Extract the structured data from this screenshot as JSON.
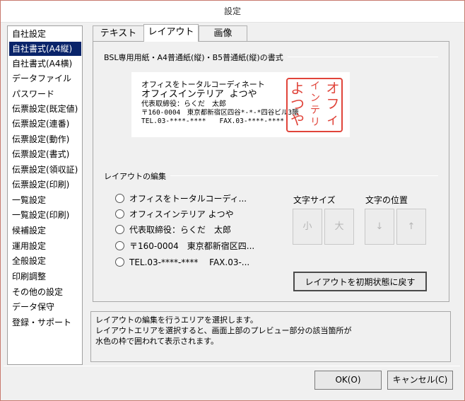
{
  "window": {
    "title": "設定"
  },
  "sidebar": {
    "items": [
      {
        "label": "自社設定"
      },
      {
        "label": "自社書式(A4縦)",
        "selected": true
      },
      {
        "label": "自社書式(A4横)"
      },
      {
        "label": "データファイル"
      },
      {
        "label": "パスワード"
      },
      {
        "label": "伝票設定(既定値)"
      },
      {
        "label": "伝票設定(連番)"
      },
      {
        "label": "伝票設定(動作)"
      },
      {
        "label": "伝票設定(書式)"
      },
      {
        "label": "伝票設定(領収証)"
      },
      {
        "label": "伝票設定(印刷)"
      },
      {
        "label": "一覧設定"
      },
      {
        "label": "一覧設定(印刷)"
      },
      {
        "label": "候補設定"
      },
      {
        "label": "運用設定"
      },
      {
        "label": "全般設定"
      },
      {
        "label": "印刷調整"
      },
      {
        "label": "その他の設定"
      },
      {
        "label": "データ保守"
      },
      {
        "label": "登録・サポート"
      }
    ]
  },
  "tabs": [
    {
      "label": "テキスト"
    },
    {
      "label": "レイアウト",
      "active": true
    },
    {
      "label": "画像"
    }
  ],
  "format_group": {
    "label": "BSL専用用紙・A4普通紙(縦)・B5普通紙(縦)の書式"
  },
  "preview": {
    "lines": [
      "オフィスをトータルコーディネート",
      "オフィスインテリア よつや",
      "代表取締役：らくだ　太郎",
      "〒160-0004　東京都新宿区四谷*-*-*四谷ビル3階",
      "TEL.03-****-****　　FAX.03-****-****"
    ],
    "stamp_columns": [
      "オフィ",
      "インテリ",
      "よつや"
    ],
    "stamp_color": "#e0443a"
  },
  "layout_edit": {
    "label": "レイアウトの編集",
    "options": [
      {
        "label": "オフィスをトータルコーディ..."
      },
      {
        "label": "オフィスインテリア よつや"
      },
      {
        "label": "代表取締役：らくだ　太郎"
      },
      {
        "label": "〒160-0004　東京都新宿区四..."
      },
      {
        "label": "TEL.03-****-****　 FAX.03-..."
      }
    ],
    "font_size_label": "文字サイズ",
    "small_button": "小",
    "large_button": "大",
    "position_label": "文字の位置",
    "down_button": "↓",
    "up_button": "↑",
    "reset_button": "レイアウトを初期状態に戻す"
  },
  "help": {
    "lines": [
      "レイアウトの編集を行うエリアを選択します。",
      "レイアウトエリアを選択すると、画面上部のプレビュー部分の該当箇所が",
      "水色の枠で囲われて表示されます。"
    ]
  },
  "footer": {
    "ok_label": "OK(O)",
    "cancel_label": "キャンセル(C)"
  }
}
